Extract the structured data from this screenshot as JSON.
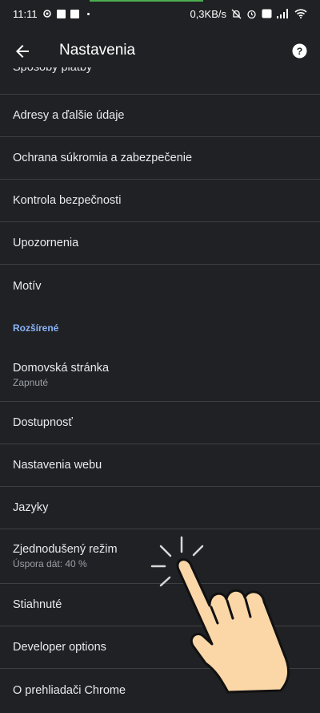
{
  "status_bar": {
    "time": "11:11",
    "net_speed": "0,3KB/s"
  },
  "app_bar": {
    "title": "Nastavenia",
    "back_icon": "arrow-back-icon",
    "help_icon": "help-icon"
  },
  "settings": {
    "partial_item": "Spôsoby platby",
    "items_basic": [
      {
        "label": "Adresy a ďalšie údaje"
      },
      {
        "label": "Ochrana súkromia a zabezpečenie"
      },
      {
        "label": "Kontrola bezpečnosti"
      },
      {
        "label": "Upozornenia"
      },
      {
        "label": "Motív"
      }
    ],
    "advanced_header": "Rozšírené",
    "items_advanced": [
      {
        "label": "Domovská stránka",
        "sub": "Zapnuté"
      },
      {
        "label": "Dostupnosť"
      },
      {
        "label": "Nastavenia webu"
      },
      {
        "label": "Jazyky"
      },
      {
        "label": "Zjednodušený režim",
        "sub": "Úspora dát: 40 %"
      },
      {
        "label": "Stiahnuté"
      },
      {
        "label": "Developer options"
      },
      {
        "label": "O prehliadači Chrome"
      }
    ]
  },
  "colors": {
    "background": "#202124",
    "divider": "#3c4043",
    "accent": "#8ab4f8"
  }
}
